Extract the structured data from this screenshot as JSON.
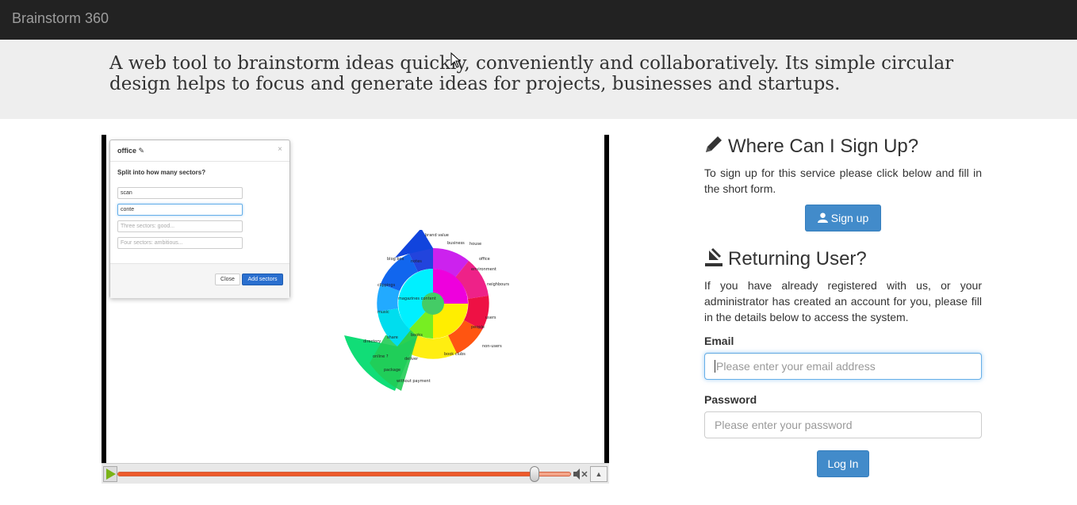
{
  "navbar": {
    "brand": "Brainstorm 360"
  },
  "hero": {
    "tagline": "A web tool to brainstorm ideas quickly, conveniently and collaboratively. Its simple circular design helps to focus and generate ideas for projects, businesses and startups."
  },
  "video": {
    "dialog": {
      "title": "office",
      "question": "Split into how many sectors?",
      "fields": [
        {
          "value": "scan",
          "placeholder": ""
        },
        {
          "value": "conte",
          "placeholder": ""
        },
        {
          "value": "",
          "placeholder": "Three sectors: good..."
        },
        {
          "value": "",
          "placeholder": "Four sectors: ambitious..."
        }
      ],
      "close_label": "Close",
      "add_label": "Add sectors"
    },
    "wheel_labels": [
      "brand value",
      "business",
      "house",
      "office",
      "environment",
      "neighbours",
      "blog box",
      "notes",
      "clippings",
      "magazines content",
      "music",
      "people",
      "users",
      "share",
      "books",
      "directory",
      "online ?",
      "deliver",
      "book clubs",
      "non-users",
      "package",
      "without payment"
    ],
    "progress": 0.92,
    "icons": {
      "play": "play-icon",
      "mute": "mute-icon",
      "fullscreen": "fullscreen-icon"
    }
  },
  "signup": {
    "heading": "Where Can I Sign Up?",
    "text": "To sign up for this service please click below and fill in the short form.",
    "button": "Sign up",
    "icon": "pencil-icon"
  },
  "login": {
    "heading": "Returning User?",
    "text": "If you have already registered with us, or your administrator has created an account for you, please fill in the details below to access the system.",
    "email_label": "Email",
    "email_placeholder": "Please enter your email address",
    "password_label": "Password",
    "password_placeholder": "Please enter your password",
    "button": "Log In",
    "icon": "login-icon"
  },
  "colors": {
    "primary": "#428bca",
    "navbar": "#222222",
    "hero_bg": "#eeeeee"
  }
}
